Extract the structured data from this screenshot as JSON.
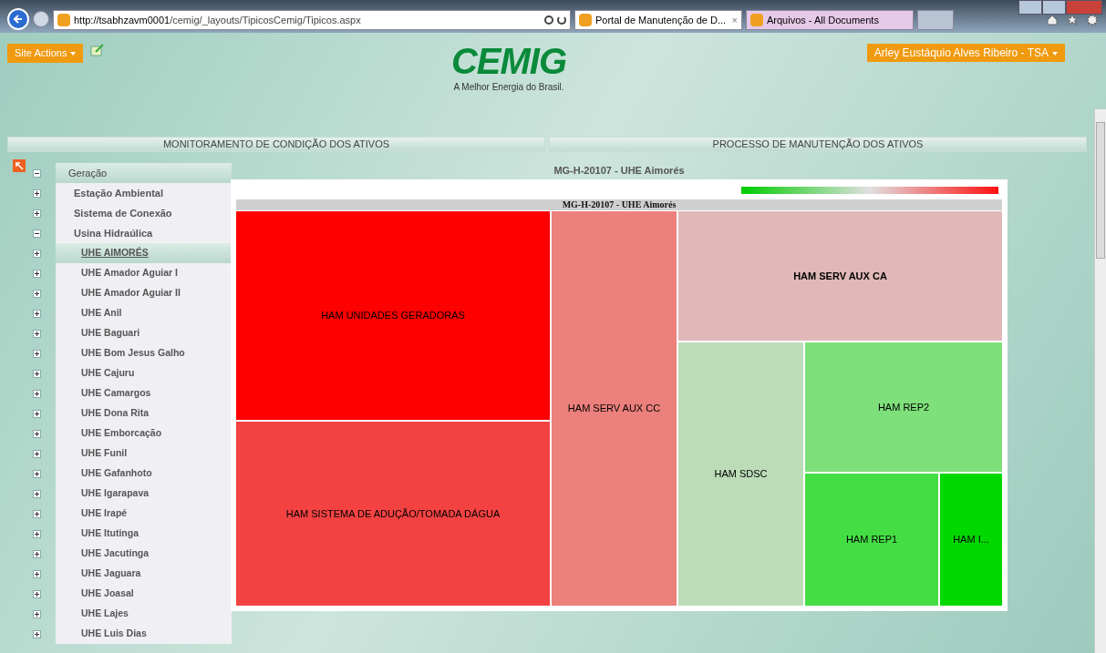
{
  "browser": {
    "url_host": "http://tsabhzavm0001",
    "url_path": "/cemig/_layouts/TipicosCemig/Tipicos.aspx",
    "tabs": [
      {
        "label": "Portal de Manutenção de D...",
        "selected": true
      },
      {
        "label": "Arquivos - All Documents",
        "selected": false
      }
    ],
    "close_tab": "×"
  },
  "header": {
    "site_actions": "Site Actions",
    "logo_text": "CEMIG",
    "tagline": "A Melhor Energia do Brasil.",
    "user": "Arley Eustáquio Alves Ribeiro - TSA"
  },
  "nav_tabs": [
    {
      "label": "MONITORAMENTO DE CONDIÇÃO DOS ATIVOS"
    },
    {
      "label": "PROCESSO DE MANUTENÇÃO DOS ATIVOS"
    }
  ],
  "tree": [
    {
      "label": "Geração",
      "expanded": true,
      "children": [
        {
          "label": "Estação Ambiental",
          "expanded": false
        },
        {
          "label": "Sistema de Conexão",
          "expanded": false
        },
        {
          "label": "Usina Hidraúlica",
          "expanded": true,
          "children": [
            {
              "label": "UHE AIMORÉS",
              "selected": true
            },
            {
              "label": "UHE Amador Aguiar I",
              "selected": false
            },
            {
              "label": "UHE Amador Aguiar II",
              "selected": false
            },
            {
              "label": "UHE Anil",
              "selected": false
            },
            {
              "label": "UHE Baguari",
              "selected": false
            },
            {
              "label": "UHE Bom Jesus Galho",
              "selected": false
            },
            {
              "label": "UHE Cajuru",
              "selected": false
            },
            {
              "label": "UHE Camargos",
              "selected": false
            },
            {
              "label": "UHE Dona Rita",
              "selected": false
            },
            {
              "label": "UHE Emborcação",
              "selected": false
            },
            {
              "label": "UHE Funil",
              "selected": false
            },
            {
              "label": "UHE Gafanhoto",
              "selected": false
            },
            {
              "label": "UHE Igarapava",
              "selected": false
            },
            {
              "label": "UHE Irapé",
              "selected": false
            },
            {
              "label": "UHE Itutinga",
              "selected": false
            },
            {
              "label": "UHE Jacutinga",
              "selected": false
            },
            {
              "label": "UHE Jaguara",
              "selected": false
            },
            {
              "label": "UHE Joasal",
              "selected": false
            },
            {
              "label": "UHE Lajes",
              "selected": false
            },
            {
              "label": "UHE Luis Dias",
              "selected": false
            }
          ]
        }
      ]
    }
  ],
  "content": {
    "heading": "MG-H-20107 - UHE Aimorés",
    "treemap": {
      "title": "MG-H-20107 - UHE Aimorés",
      "cells": [
        {
          "label": "HAM UNIDADES GERADORAS",
          "color": "#ff0000"
        },
        {
          "label": "HAM SISTEMA DE ADUÇÃO/TOMADA DÁGUA",
          "color": "#f44242"
        },
        {
          "label": "HAM SERV AUX CC",
          "color": "#ec807c"
        },
        {
          "label": "HAM SERV AUX CA",
          "color": "#e0b8b8",
          "bold": true
        },
        {
          "label": "HAM SDSC",
          "color": "#bcdcb8"
        },
        {
          "label": "HAM REP2",
          "color": "#7ee07a"
        },
        {
          "label": "HAM REP1",
          "color": "#44de44"
        },
        {
          "label": "HAM I...",
          "color": "#00d800"
        }
      ]
    }
  }
}
